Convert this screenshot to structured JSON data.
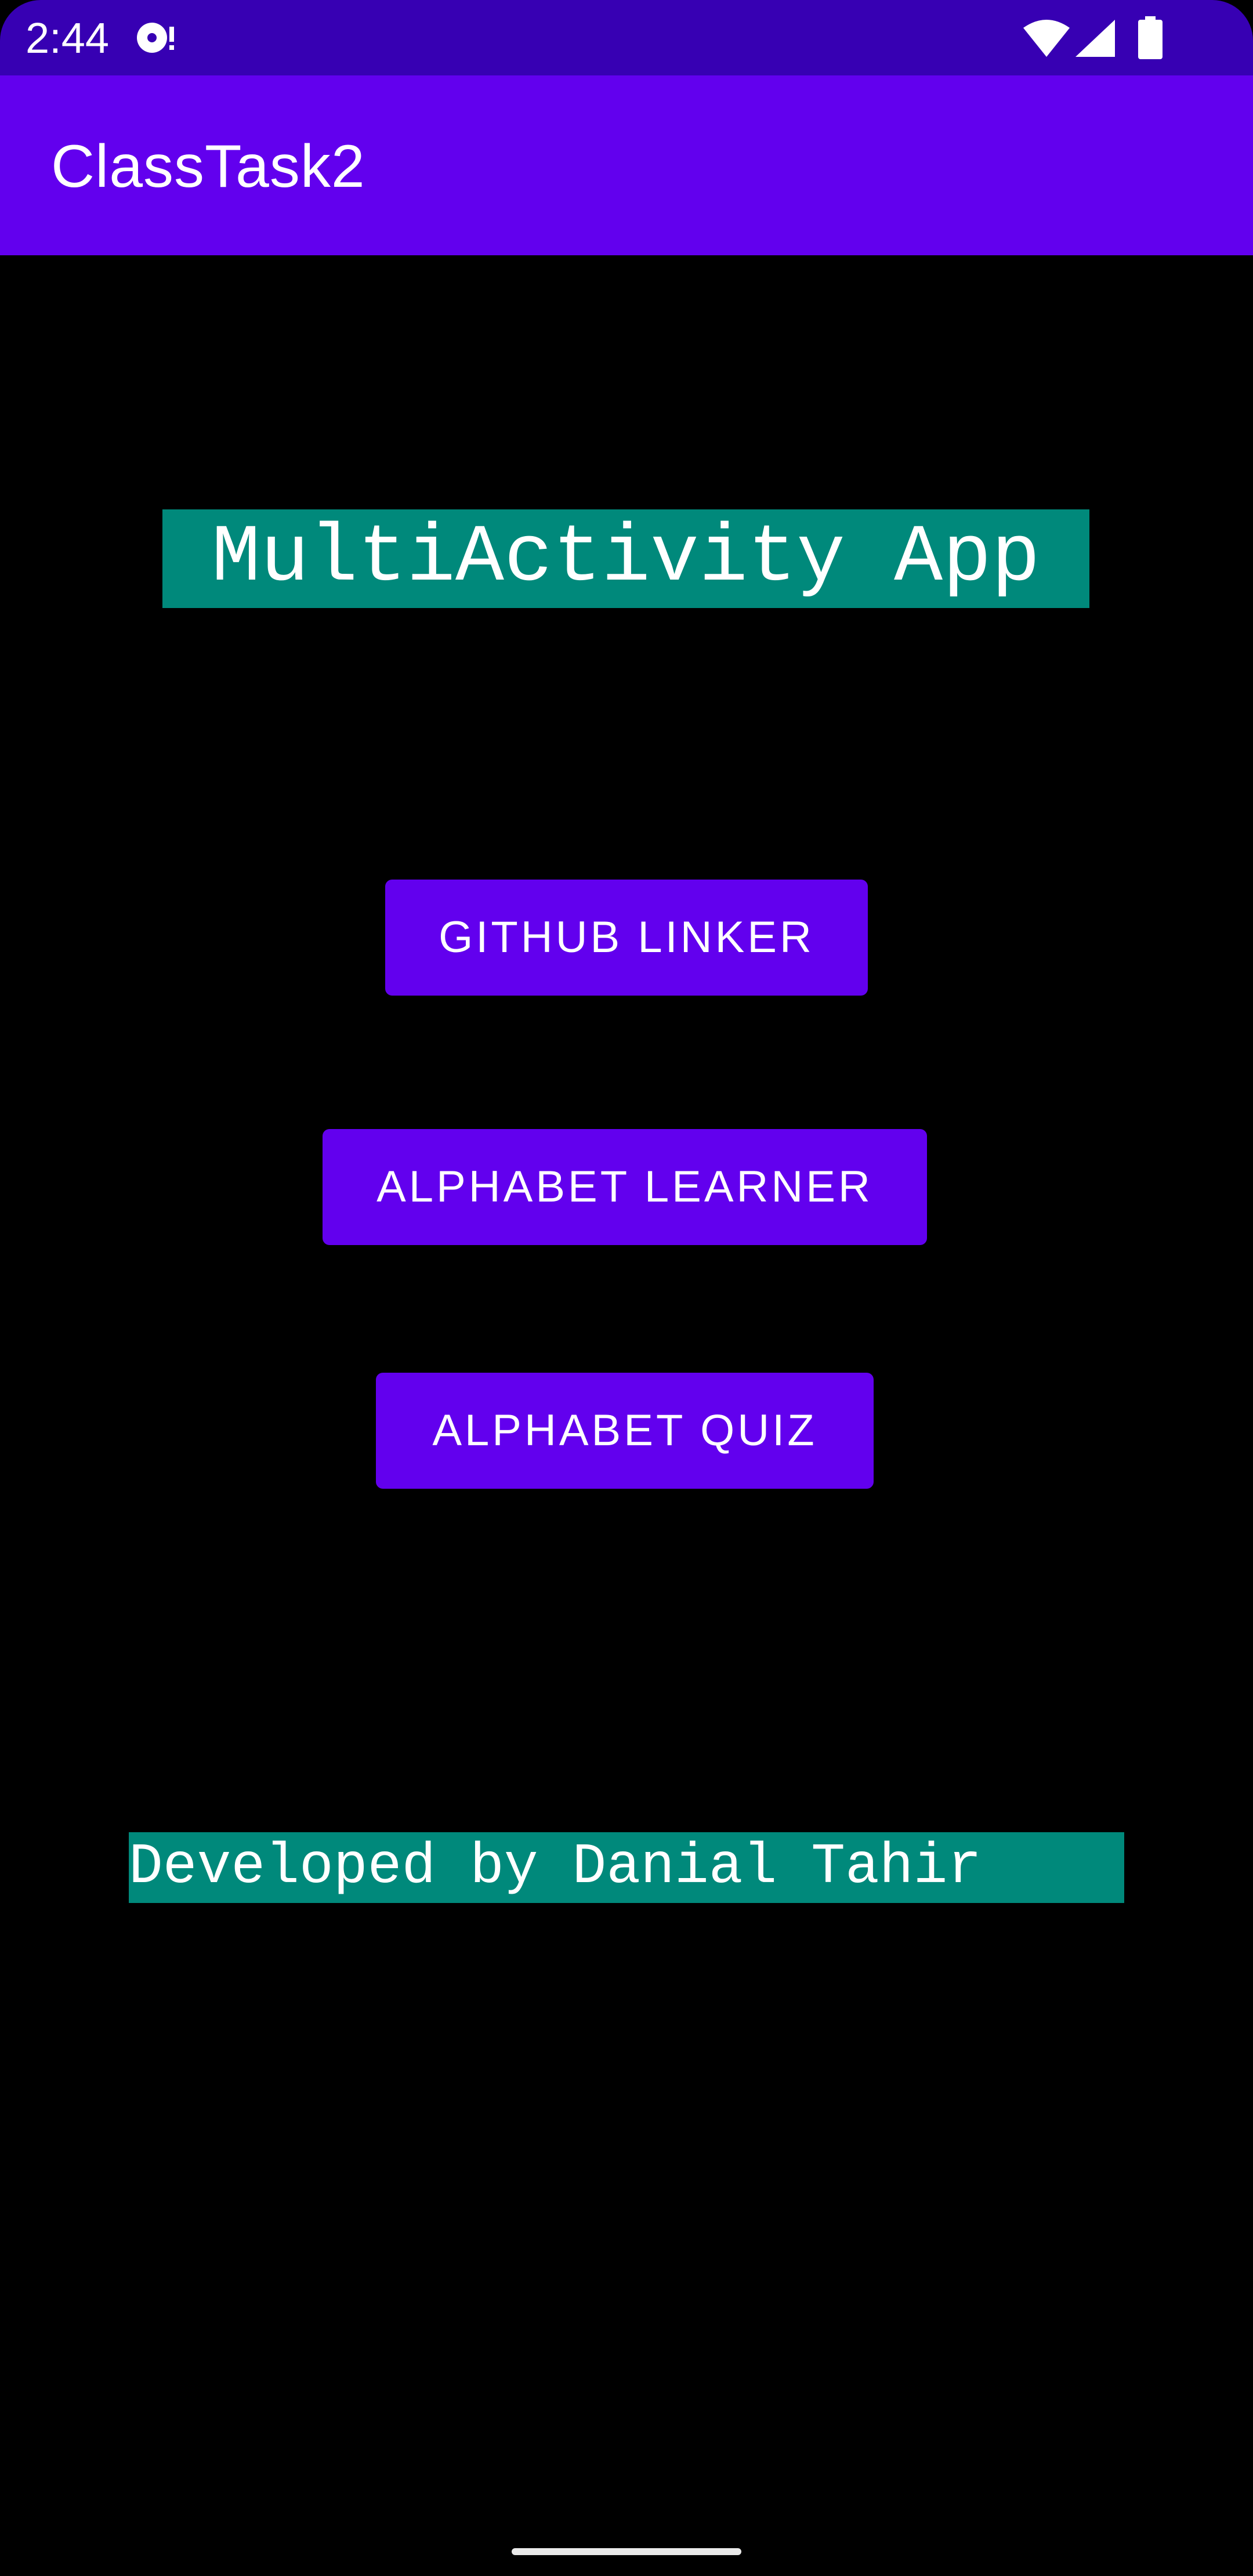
{
  "status_bar": {
    "time": "2:44",
    "icons": [
      "media-notification-icon",
      "wifi-icon",
      "signal-icon",
      "battery-icon"
    ]
  },
  "app_bar": {
    "title": "ClassTask2"
  },
  "main": {
    "heading": "MultiActivity App",
    "buttons": [
      {
        "label": "GITHUB LINKER"
      },
      {
        "label": "ALPHABET LEARNER"
      },
      {
        "label": "ALPHABET QUIZ"
      }
    ],
    "credit": "Developed by Danial Tahir"
  },
  "colors": {
    "status_bar": "#3700B3",
    "app_bar": "#6200EE",
    "button": "#6200EE",
    "label_background": "#00897B",
    "background": "#000000",
    "text": "#FFFFFF"
  }
}
